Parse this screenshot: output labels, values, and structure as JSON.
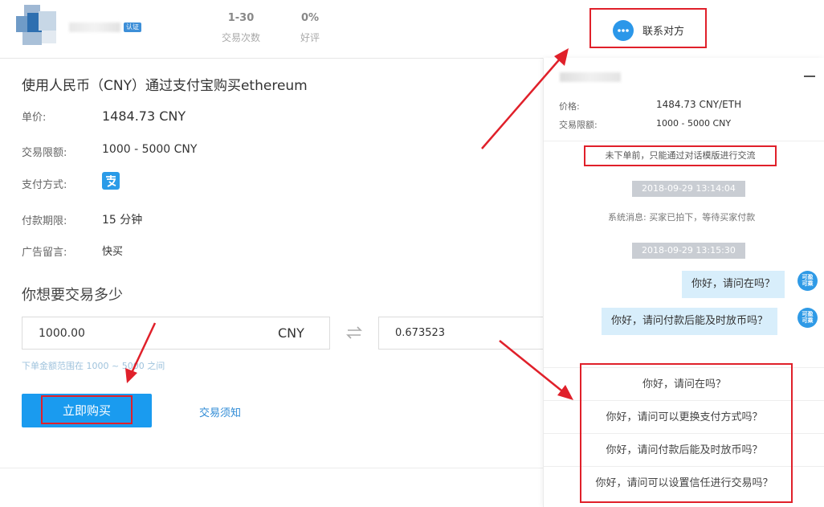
{
  "seller": {
    "verify_badge": "认证",
    "stats": [
      {
        "value": "1-30",
        "label": "交易次数"
      },
      {
        "value": "0%",
        "label": "好评"
      }
    ]
  },
  "contact": {
    "label": "联系对方",
    "icon": "chat-bubble-icon"
  },
  "offer": {
    "title": "使用人民币（CNY）通过支付宝购买ethereum",
    "rows": [
      {
        "label": "单价:",
        "value": "1484.73 CNY"
      },
      {
        "label": "交易限额:",
        "value": "1000 - 5000 CNY"
      },
      {
        "label": "支付方式:",
        "value": "alipay-icon"
      },
      {
        "label": "付款期限:",
        "value": "15 分钟"
      },
      {
        "label": "广告留言:",
        "value": "快买"
      }
    ]
  },
  "trade": {
    "heading": "你想要交易多少",
    "amount_value": "1000.00",
    "currency": "CNY",
    "swap_icon": "swap-arrows-icon",
    "crypto_value": "0.673523",
    "hint": "下单金额范围在 1000 ~ 5000 之间",
    "buy_label": "立即购买",
    "notice_label": "交易须知"
  },
  "chat": {
    "price_label": "价格:",
    "price_value": "1484.73 CNY/ETH",
    "limit_label": "交易限额:",
    "limit_value": "1000 - 5000 CNY",
    "notice": "未下单前，只能通过对话模版进行交流",
    "messages": [
      {
        "type": "time",
        "text": "2018-09-29 13:14:04"
      },
      {
        "type": "system",
        "text": "系统消息: 买家已拍下，等待买家付款"
      },
      {
        "type": "time",
        "text": "2018-09-29 13:15:30"
      },
      {
        "type": "bubble",
        "text": "你好，请问在吗？",
        "avatar": "可盈\n可乘"
      },
      {
        "type": "bubble",
        "text": "你好，请问付款后能及时放币吗？",
        "avatar": "可盈\n可乘"
      }
    ],
    "quick_replies": [
      "你好，请问在吗？",
      "你好，请问可以更换支付方式吗？",
      "你好，请问付款后能及时放币吗？",
      "你好，请问可以设置信任进行交易吗？"
    ]
  },
  "colors": {
    "accent": "#1a9bef",
    "annotation": "#e0202a"
  }
}
